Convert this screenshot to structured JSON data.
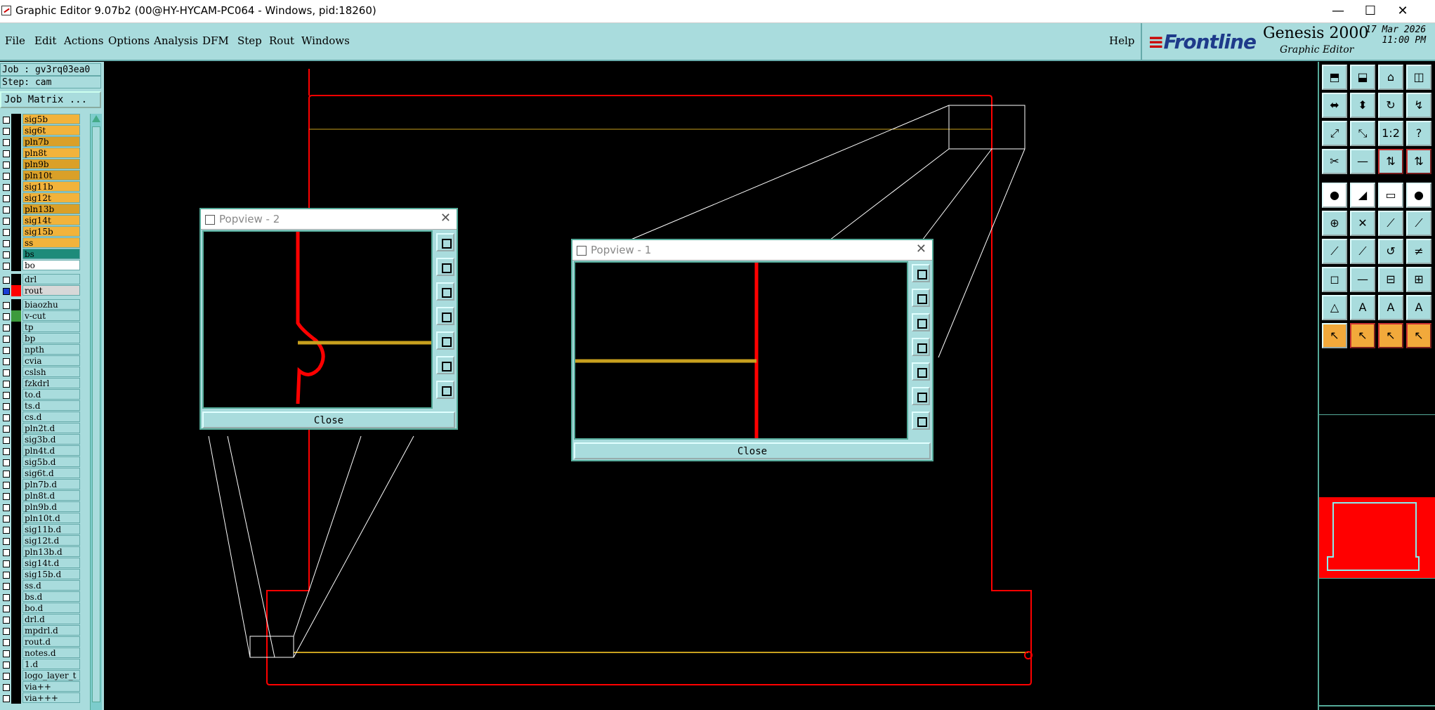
{
  "window": {
    "title": "Graphic Editor 9.07b2 (00@HY-HYCAM-PC064 - Windows, pid:18260)",
    "minimize": "—",
    "maximize": "☐",
    "close": "✕"
  },
  "menu": {
    "file": "File",
    "edit": "Edit",
    "actions": "Actions",
    "options": "Options",
    "analysis": "Analysis",
    "dfm": "DFM",
    "step": "Step",
    "rout": "Rout",
    "windows": "Windows",
    "help": "Help"
  },
  "brand": {
    "frontline": "Frontline",
    "product": "Genesis 2000",
    "subtitle": "Graphic Editor",
    "date": "17 Mar 2026",
    "time": "11:00 PM"
  },
  "job": {
    "job_label": "Job : gv3rq03ea0",
    "step_label": "Step: cam",
    "job_matrix": "Job Matrix ..."
  },
  "layers": [
    {
      "name": "sig5b",
      "color": "#f2b33b"
    },
    {
      "name": "sig6t",
      "color": "#f2b33b"
    },
    {
      "name": "pln7b",
      "color": "#daa028"
    },
    {
      "name": "pln8t",
      "color": "#f2b33b"
    },
    {
      "name": "pln9b",
      "color": "#daa028"
    },
    {
      "name": "pln10t",
      "color": "#daa028"
    },
    {
      "name": "sig11b",
      "color": "#f2b33b"
    },
    {
      "name": "sig12t",
      "color": "#f2b33b"
    },
    {
      "name": "pln13b",
      "color": "#daa028"
    },
    {
      "name": "sig14t",
      "color": "#f2b33b"
    },
    {
      "name": "sig15b",
      "color": "#f2b33b"
    },
    {
      "name": "ss",
      "color": "#f2b33b"
    },
    {
      "name": "bs",
      "color": "#1d8b7a"
    },
    {
      "name": "bo",
      "color": "#ffffff"
    },
    {
      "name": "drl",
      "color": "#a9dcdd"
    },
    {
      "name": "rout",
      "color": "#d8d8d8"
    },
    {
      "name": "biaozhu",
      "color": "#a9dcdd"
    },
    {
      "name": "v-cut",
      "color": "#a9dcdd"
    },
    {
      "name": "tp",
      "color": "#a9dcdd"
    },
    {
      "name": "bp",
      "color": "#a9dcdd"
    },
    {
      "name": "npth",
      "color": "#a9dcdd"
    },
    {
      "name": "cvia",
      "color": "#a9dcdd"
    },
    {
      "name": "cslsh",
      "color": "#a9dcdd"
    },
    {
      "name": "fzkdrl",
      "color": "#a9dcdd"
    },
    {
      "name": "to.d",
      "color": "#a9dcdd"
    },
    {
      "name": "ts.d",
      "color": "#a9dcdd"
    },
    {
      "name": "cs.d",
      "color": "#a9dcdd"
    },
    {
      "name": "pln2t.d",
      "color": "#a9dcdd"
    },
    {
      "name": "sig3b.d",
      "color": "#a9dcdd"
    },
    {
      "name": "pln4t.d",
      "color": "#a9dcdd"
    },
    {
      "name": "sig5b.d",
      "color": "#a9dcdd"
    },
    {
      "name": "sig6t.d",
      "color": "#a9dcdd"
    },
    {
      "name": "pln7b.d",
      "color": "#a9dcdd"
    },
    {
      "name": "pln8t.d",
      "color": "#a9dcdd"
    },
    {
      "name": "pln9b.d",
      "color": "#a9dcdd"
    },
    {
      "name": "pln10t.d",
      "color": "#a9dcdd"
    },
    {
      "name": "sig11b.d",
      "color": "#a9dcdd"
    },
    {
      "name": "sig12t.d",
      "color": "#a9dcdd"
    },
    {
      "name": "pln13b.d",
      "color": "#a9dcdd"
    },
    {
      "name": "sig14t.d",
      "color": "#a9dcdd"
    },
    {
      "name": "sig15b.d",
      "color": "#a9dcdd"
    },
    {
      "name": "ss.d",
      "color": "#a9dcdd"
    },
    {
      "name": "bs.d",
      "color": "#a9dcdd"
    },
    {
      "name": "bo.d",
      "color": "#a9dcdd"
    },
    {
      "name": "drl.d",
      "color": "#a9dcdd"
    },
    {
      "name": "mpdrl.d",
      "color": "#a9dcdd"
    },
    {
      "name": "rout.d",
      "color": "#a9dcdd"
    },
    {
      "name": "notes.d",
      "color": "#a9dcdd"
    },
    {
      "name": "1.d",
      "color": "#a9dcdd"
    },
    {
      "name": "logo_layer_t",
      "color": "#a9dcdd"
    },
    {
      "name": "via++",
      "color": "#a9dcdd"
    },
    {
      "name": "via+++",
      "color": "#a9dcdd"
    }
  ],
  "popview2": {
    "title": "Popview - 2",
    "close_label": "Close"
  },
  "popview1": {
    "title": "Popview - 1",
    "close_label": "Close"
  },
  "colors": {
    "accent": "#a9dcdd",
    "profile_red": "#ff0000",
    "feature_gold": "#c8a01e"
  },
  "toolbox": [
    "home-icon",
    "zoom-icon",
    "pan-icon",
    "redraw-icon",
    "clear-icon",
    "measure-icon",
    "select-icon",
    "route-icon"
  ]
}
